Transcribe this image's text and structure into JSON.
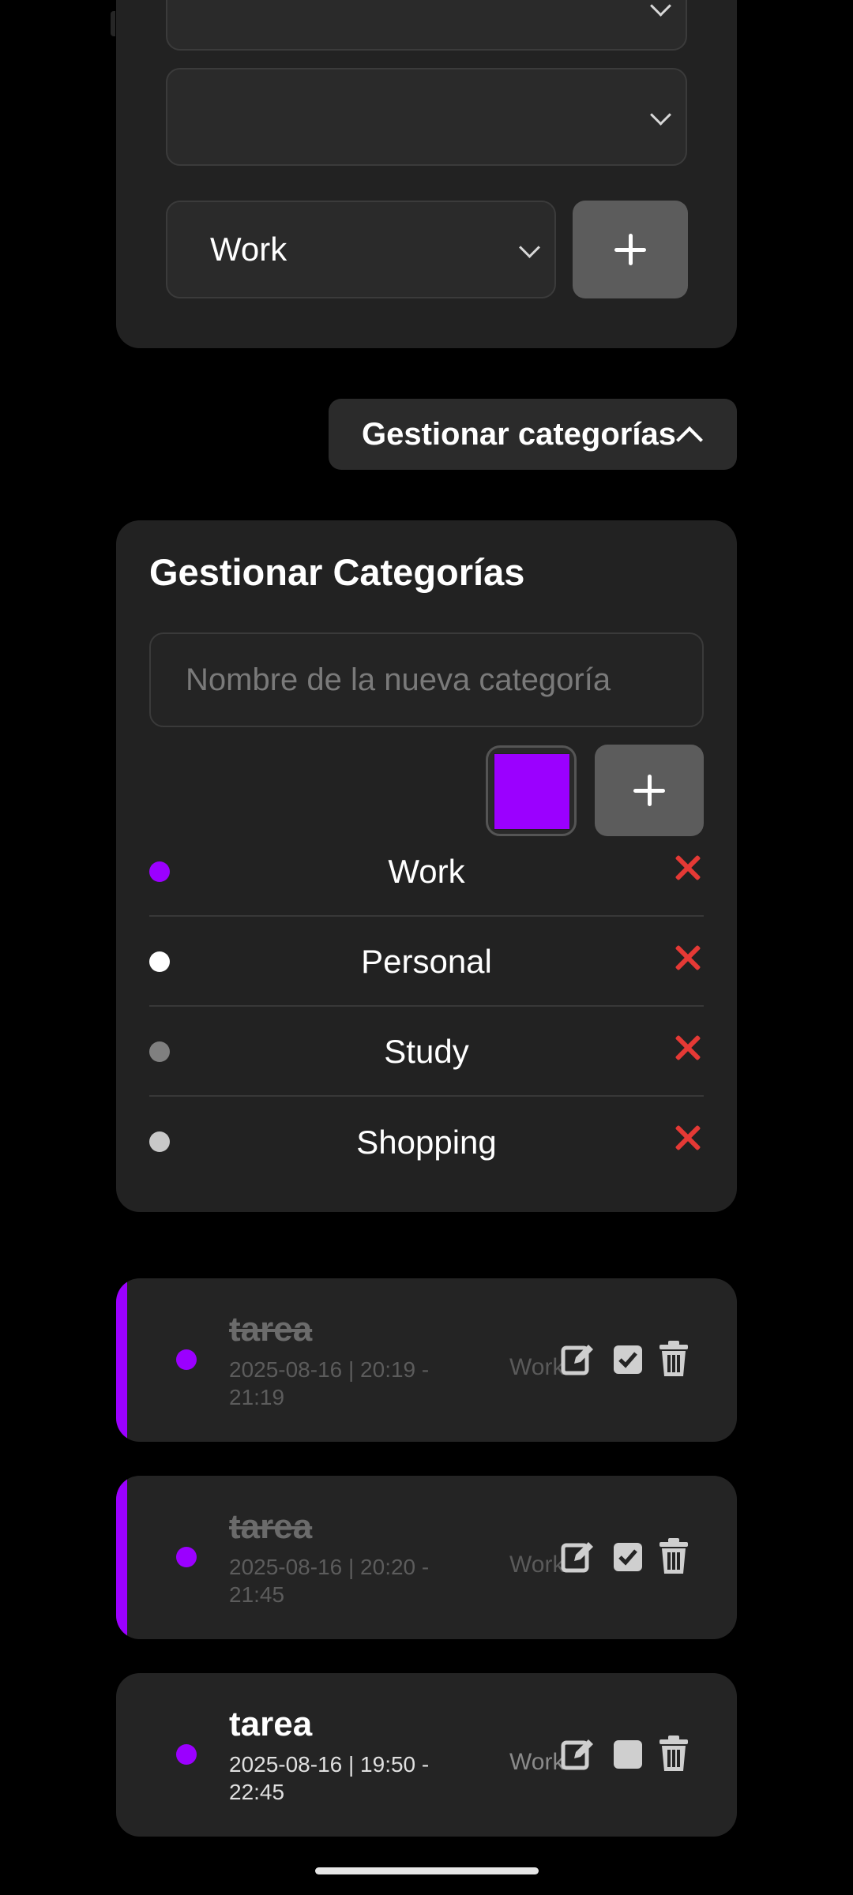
{
  "form": {
    "category_select_value": "Work"
  },
  "manage_toggle": {
    "label": "Gestionar categorías"
  },
  "categories_panel": {
    "title": "Gestionar Categorías",
    "input_placeholder": "Nombre de la nueva categoría",
    "selected_color": "#9b00ff",
    "items": [
      {
        "name": "Work",
        "color": "#9b00ff"
      },
      {
        "name": "Personal",
        "color": "#ffffff"
      },
      {
        "name": "Study",
        "color": "#808080"
      },
      {
        "name": "Shopping",
        "color": "#c8c8c8"
      }
    ]
  },
  "tasks": [
    {
      "title": "tarea",
      "date_line1": "2025-08-16 | 20:19 -",
      "date_line2": "21:19",
      "category": "Work",
      "completed": true,
      "color": "#9b00ff"
    },
    {
      "title": "tarea",
      "date_line1": "2025-08-16 | 20:20 -",
      "date_line2": "21:45",
      "category": "Work",
      "completed": true,
      "color": "#9b00ff"
    },
    {
      "title": "tarea",
      "date_line1": "2025-08-16 | 19:50 -",
      "date_line2": "22:45",
      "category": "Work",
      "completed": false,
      "color": "#9b00ff"
    }
  ],
  "icons": {
    "edit": "edit-icon",
    "check": "checkbox-icon",
    "delete": "trash-icon",
    "add": "plus-icon",
    "remove": "close-icon",
    "expand": "chevron-down-icon",
    "collapse": "chevron-up-icon"
  }
}
